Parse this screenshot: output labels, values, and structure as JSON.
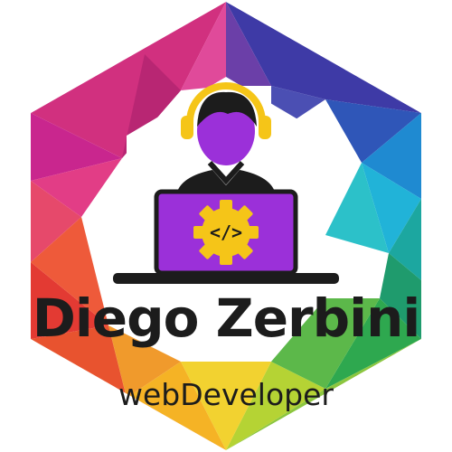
{
  "name": "Diego Zerbini",
  "role": "webDeveloper",
  "laptop_code_symbol": "</>",
  "colors": {
    "text": "#1c1c1c",
    "laptop": "#9b30d9",
    "gear": "#f5c518",
    "headset": "#f5c518",
    "skin": "#9b30d9",
    "hair": "#1c1c1c"
  }
}
